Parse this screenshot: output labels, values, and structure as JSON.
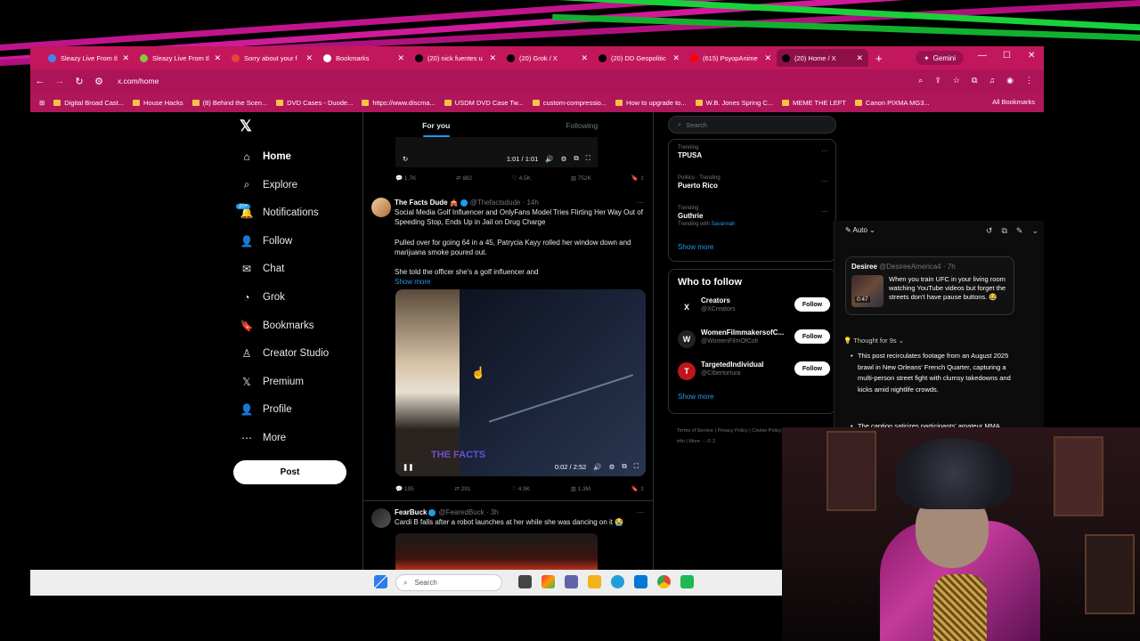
{
  "browser": {
    "tabs": [
      {
        "title": "Sleazy Live From tl",
        "icon": "google-docs-icon",
        "color": "#4285f4"
      },
      {
        "title": "Sleazy Live From tl",
        "icon": "rumble-icon",
        "color": "#85c742"
      },
      {
        "title": "Sorry about your f",
        "icon": "gmail-icon",
        "color": "#ea4335"
      },
      {
        "title": "Bookmarks",
        "icon": "star-icon",
        "color": "#ffffff"
      },
      {
        "title": "(20) nick fuentes u",
        "icon": "x-icon",
        "color": "#000000"
      },
      {
        "title": "(20) Grok / X",
        "icon": "x-icon",
        "color": "#000000"
      },
      {
        "title": "(20) DD Geopolitic",
        "icon": "x-icon",
        "color": "#000000"
      },
      {
        "title": "(615) PsyopAnime",
        "icon": "youtube-icon",
        "color": "#ff0000"
      },
      {
        "title": "(20) Home / X",
        "icon": "x-icon",
        "color": "#000000",
        "active": true
      }
    ],
    "gemini_label": "Gemini",
    "url": "x.com/home",
    "bookmarks": [
      "Digital Broad Cast...",
      "House Hacks",
      "(8) Behind the Scen...",
      "DVD Cases - Duode...",
      "https://www.discma...",
      "USDM DVD Case Tw...",
      "custom-compressio...",
      "How to upgrade to...",
      "W.B. Jones Spring C...",
      "MEME THE LEFT",
      "Canon PIXMA MG3..."
    ],
    "all_bookmarks": "All Bookmarks"
  },
  "nav": {
    "items": [
      {
        "label": "Home",
        "icon": "home-icon",
        "glyph": "⌂"
      },
      {
        "label": "Explore",
        "icon": "search-icon",
        "glyph": "⌕"
      },
      {
        "label": "Notifications",
        "icon": "bell-icon",
        "glyph": "🔔",
        "badge": "20+"
      },
      {
        "label": "Follow",
        "icon": "add-person-icon",
        "glyph": "👤"
      },
      {
        "label": "Chat",
        "icon": "mail-icon",
        "glyph": "✉"
      },
      {
        "label": "Grok",
        "icon": "grok-icon",
        "glyph": "◔"
      },
      {
        "label": "Bookmarks",
        "icon": "bookmark-icon",
        "glyph": "🔖"
      },
      {
        "label": "Creator Studio",
        "icon": "creator-icon",
        "glyph": "♙"
      },
      {
        "label": "Premium",
        "icon": "x-premium-icon",
        "glyph": "𝕏"
      },
      {
        "label": "Profile",
        "icon": "person-icon",
        "glyph": "👤"
      },
      {
        "label": "More",
        "icon": "more-circle-icon",
        "glyph": "⋯"
      }
    ],
    "post_label": "Post"
  },
  "feed": {
    "tabs": [
      "For you",
      "Following"
    ],
    "video1": {
      "time": "1:01 / 1:01"
    },
    "stats1": {
      "replies": "1.7K",
      "reposts": "882",
      "likes": "4.5K",
      "views": "752K"
    },
    "tweet1": {
      "name": "The Facts Dude 🎪",
      "handle": "@Thefactsdude · 14h",
      "headline": "Social Media Golf Influencer and OnlyFans Model Tries Flirting Her Way Out of Speeding Stop, Ends Up in Jail on Drug Charge",
      "para1": "Pulled over for going 64 in a 45, Patrycia Kayy rolled her window down and marijuana smoke poured out.",
      "para2": "She told the officer she's a golf influencer and",
      "show_more": "Show more",
      "watermark": "THE FACTS",
      "time": "0:02 / 2:52"
    },
    "stats2": {
      "replies": "195",
      "reposts": "291",
      "likes": "4.9K",
      "views": "1.3M"
    },
    "tweet2": {
      "name": "FearBuck",
      "handle": "@FearedBuck · 3h",
      "text": "Cardi B falls after a robot launches at her while she was dancing on it 😭"
    }
  },
  "right": {
    "search_placeholder": "Search",
    "trends": [
      {
        "context": "Trending",
        "name": "TPUSA"
      },
      {
        "context": "Politics · Trending",
        "name": "Puerto Rico"
      },
      {
        "context": "Trending",
        "name": "Guthrie",
        "sub": "Trending with",
        "sub_link": "Savannah"
      }
    ],
    "show_more": "Show more",
    "who_to_follow": "Who to follow",
    "suggestions": [
      {
        "name": "Creators",
        "handle": "@XCreators",
        "avatar": "X",
        "color": "#000000"
      },
      {
        "name": "WomenFilmmakersofC...",
        "handle": "@WomenFilmOfColr",
        "avatar": "W",
        "color": "#222222"
      },
      {
        "name": "TargetedIndividual",
        "handle": "@CIbertortura",
        "avatar": "T",
        "color": "#c0141e"
      }
    ],
    "follow_label": "Follow",
    "footer": "Terms of Service  |  Privacy Policy  |  Cookie Policy  |  Accessibility  |  Ads info  |  More ···  © 2"
  },
  "grok": {
    "mode": "Auto",
    "card": {
      "name": "Desiree",
      "handle": "@DesireeAmerica4 · 7h",
      "text": "When you train UFC in your living room watching YouTube videos but forget the streets don't have pause buttons. 😂",
      "duration": "0:47"
    },
    "thought": "Thought for 9s",
    "bullets": [
      "This post recirculates footage from an August 2025 brawl in New Orleans' French Quarter, capturing a multi-person street fight with clumsy takedowns and kicks amid nightlife crowds.",
      "The caption satirizes participants' amateur MMA attempts, while the video's comic highlight is a woman in a green pageant dress calmly walking through the chaos with"
    ]
  },
  "taskbar": {
    "search_placeholder": "Search"
  }
}
